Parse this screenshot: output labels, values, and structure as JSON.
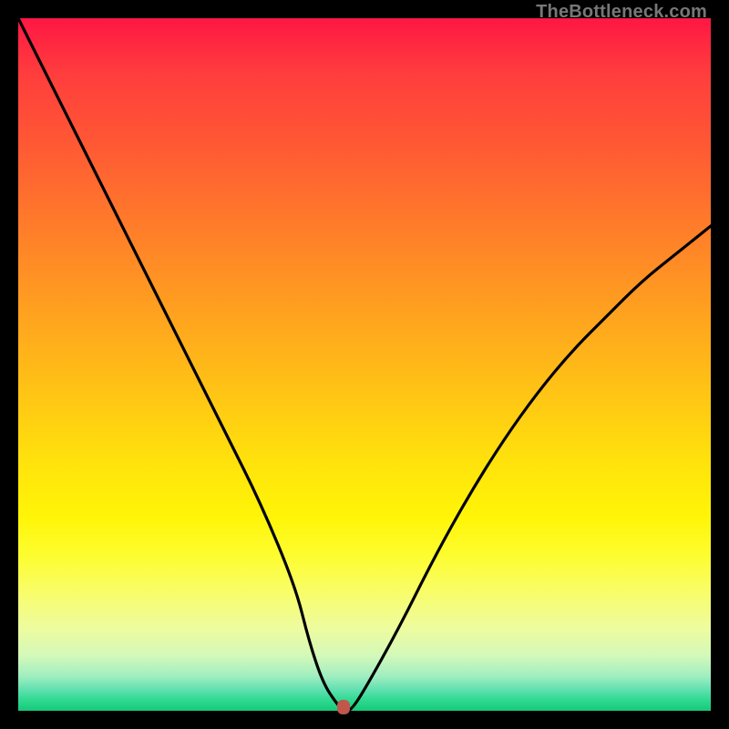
{
  "watermark": "TheBottleneck.com",
  "colors": {
    "frame": "#000000",
    "marker": "#c0564c",
    "curve": "#000000"
  },
  "chart_data": {
    "type": "line",
    "title": "",
    "xlabel": "",
    "ylabel": "",
    "xlim": [
      0,
      100
    ],
    "ylim": [
      0,
      100
    ],
    "series": [
      {
        "name": "bottleneck-curve",
        "x": [
          0,
          5,
          10,
          15,
          20,
          25,
          30,
          35,
          40,
          42,
          44,
          46,
          47,
          48,
          50,
          55,
          60,
          65,
          70,
          75,
          80,
          85,
          90,
          95,
          100
        ],
        "y": [
          100,
          90,
          80,
          70,
          60,
          50,
          40,
          30,
          18,
          10,
          4,
          1,
          0,
          0,
          3,
          12,
          22,
          31,
          39,
          46,
          52,
          57,
          62,
          66,
          70
        ]
      }
    ],
    "minimum_point": {
      "x": 47,
      "y": 0
    }
  }
}
